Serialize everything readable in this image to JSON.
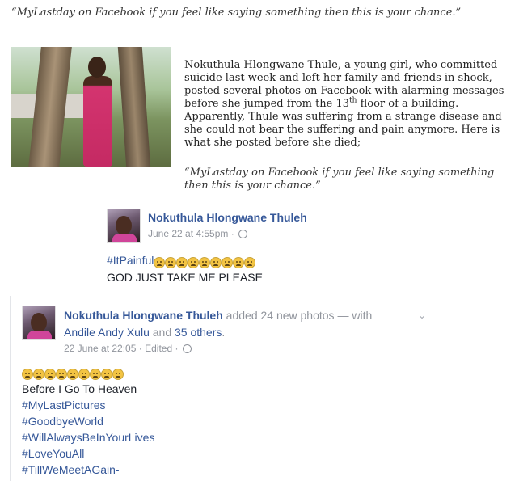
{
  "article": {
    "top_quote": "“MyLastday on Facebook if you feel like saying something then this is your chance.”",
    "photo_alt": "photo of Nokuthula Hlongwane Thule",
    "paragraph_1_a": "Nokuthula Hlongwane Thule, a young girl, who committed suicide last week and left her family and friends in shock, posted several photos on Facebook with alarming messages before she jumped from the 13",
    "paragraph_1_sup": "th",
    "paragraph_1_b": " floor of a building.",
    "paragraph_2": "Apparently, Thule was suffering from a strange disease and she could not bear the suffering and pain anymore. Here is what she posted before she died;",
    "quote_2": "“MyLastday on Facebook if you feel like saying something then this is your chance.”"
  },
  "post_1": {
    "author": "Nokuthula Hlongwane Thuleh",
    "timestamp": "June 22 at 4:55pm",
    "separator": "·",
    "hashtag": "#ItPainful",
    "emoji_count": 9,
    "line_2": "GOD JUST TAKE ME PLEASE"
  },
  "post_2": {
    "author": "Nokuthula Hlongwane Thuleh",
    "action": " added 24 new photos",
    "with_text": " — with",
    "tagged_name": "Andile Andy Xulu",
    "and_text": " and ",
    "others": "35 others",
    "period": ".",
    "timestamp": "22 June at 22:05",
    "edited": "Edited",
    "separator": "·",
    "emoji_count": 9,
    "lines": [
      "Before I Go To Heaven"
    ],
    "hashtags": [
      "#MyLastPictures",
      "#GoodbyeWorld",
      "#WillAlwaysBeInYourLives",
      "#LoveYouAll",
      "#TillWeMeetAGain-"
    ],
    "chevron": "⌄"
  },
  "colors": {
    "link": "#365899",
    "meta": "#90949c",
    "text": "#1d2129"
  }
}
